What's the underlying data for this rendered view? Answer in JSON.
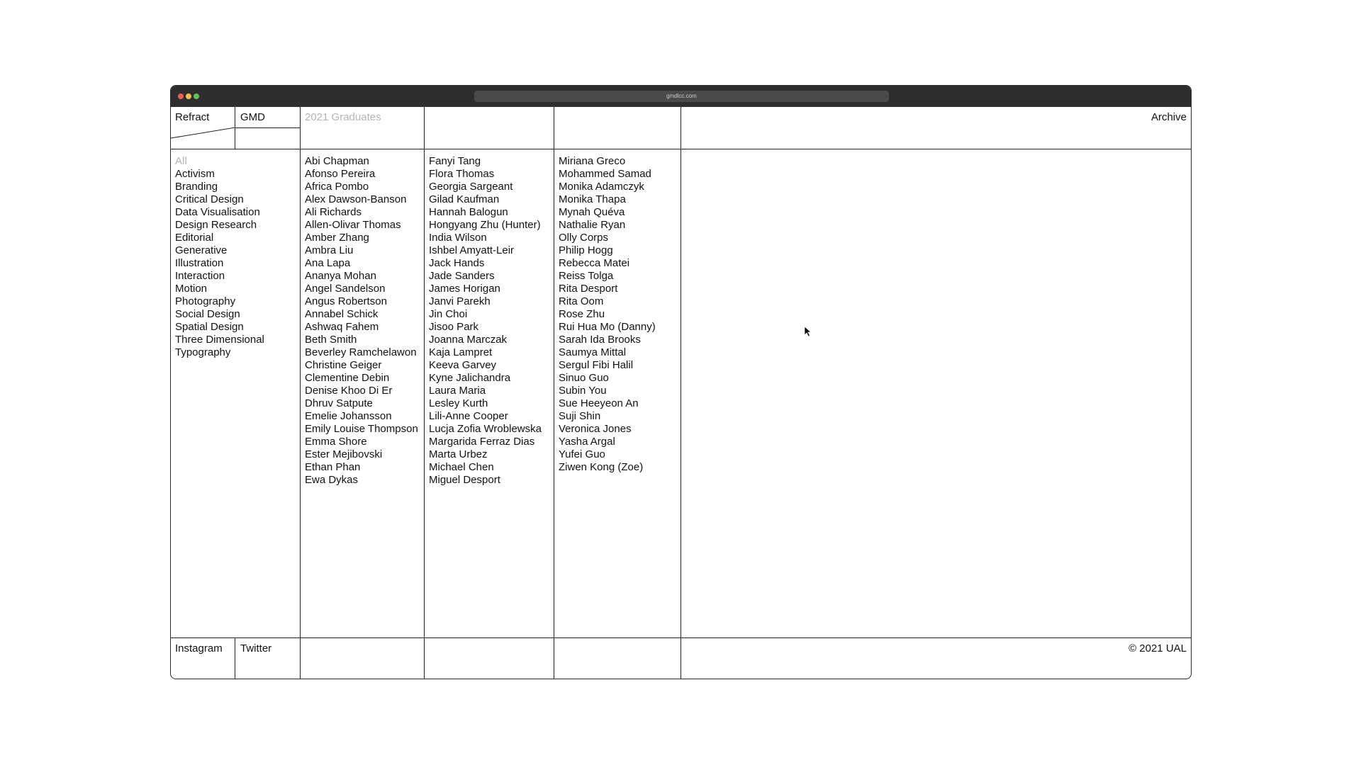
{
  "browser": {
    "url": "gmdlcc.com"
  },
  "header": {
    "brand": "Refract",
    "course": "GMD",
    "title": "2021 Graduates",
    "archive": "Archive"
  },
  "categories": [
    {
      "label": "All",
      "active": true
    },
    {
      "label": "Activism"
    },
    {
      "label": "Branding"
    },
    {
      "label": "Critical Design"
    },
    {
      "label": "Data Visualisation"
    },
    {
      "label": "Design Research"
    },
    {
      "label": "Editorial"
    },
    {
      "label": "Generative"
    },
    {
      "label": "Illustration"
    },
    {
      "label": "Interaction"
    },
    {
      "label": "Motion"
    },
    {
      "label": "Photography"
    },
    {
      "label": "Social Design"
    },
    {
      "label": "Spatial Design"
    },
    {
      "label": "Three Dimensional"
    },
    {
      "label": "Typography"
    }
  ],
  "graduates": {
    "column1": [
      "Abi Chapman",
      "Afonso Pereira",
      "Africa Pombo",
      "Alex Dawson-Banson",
      "Ali Richards",
      "Allen-Olivar Thomas",
      "Amber Zhang",
      "Ambra Liu",
      "Ana Lapa",
      "Ananya Mohan",
      "Angel Sandelson",
      "Angus Robertson",
      "Annabel Schick",
      "Ashwaq Fahem",
      "Beth Smith",
      "Beverley Ramchelawon",
      "Christine Geiger",
      "Clementine Debin",
      "Denise Khoo Di Er",
      "Dhruv Satpute",
      "Emelie Johansson",
      "Emily Louise Thompson",
      "Emma Shore",
      "Ester Mejibovski",
      "Ethan Phan",
      "Ewa Dykas"
    ],
    "column2": [
      "Fanyi Tang",
      "Flora Thomas",
      "Georgia Sargeant",
      "Gilad Kaufman",
      "Hannah Balogun",
      "Hongyang Zhu (Hunter)",
      "India Wilson",
      "Ishbel Amyatt-Leir",
      "Jack Hands",
      "Jade Sanders",
      "James Horigan",
      "Janvi Parekh",
      "Jin Choi",
      "Jisoo Park",
      "Joanna Marczak",
      "Kaja Lampret",
      "Keeva Garvey",
      "Kyne Jalichandra",
      "Laura Maria",
      "Lesley Kurth",
      "Lili-Anne Cooper",
      "Lucja Zofia Wroblewska",
      "Margarida Ferraz Dias",
      "Marta Urbez",
      "Michael Chen",
      "Miguel Desport"
    ],
    "column3": [
      "Miriana Greco",
      "Mohammed Samad",
      "Monika Adamczyk",
      "Monika Thapa",
      "Mynah Quéva",
      "Nathalie Ryan",
      "Olly Corps",
      "Philip Hogg",
      "Rebecca Matei",
      "Reiss Tolga",
      "Rita Desport",
      "Rita Oom",
      "Rose Zhu",
      "Rui Hua Mo (Danny)",
      "Sarah Ida Brooks",
      "Saumya Mittal",
      "Sergul Fibi Halil",
      "Sinuo Guo",
      "Subin You",
      "Sue Heeyeon An",
      "Suji Shin",
      "Veronica Jones",
      "Yasha Argal",
      "Yufei Guo",
      "Ziwen Kong (Zoe)"
    ]
  },
  "footer": {
    "instagram": "Instagram",
    "twitter": "Twitter",
    "copyright": "© 2021 UAL"
  },
  "colors": {
    "muted_text": "#b4b4b4",
    "titlebar": "#2e2e2e",
    "lines": "#222222"
  }
}
